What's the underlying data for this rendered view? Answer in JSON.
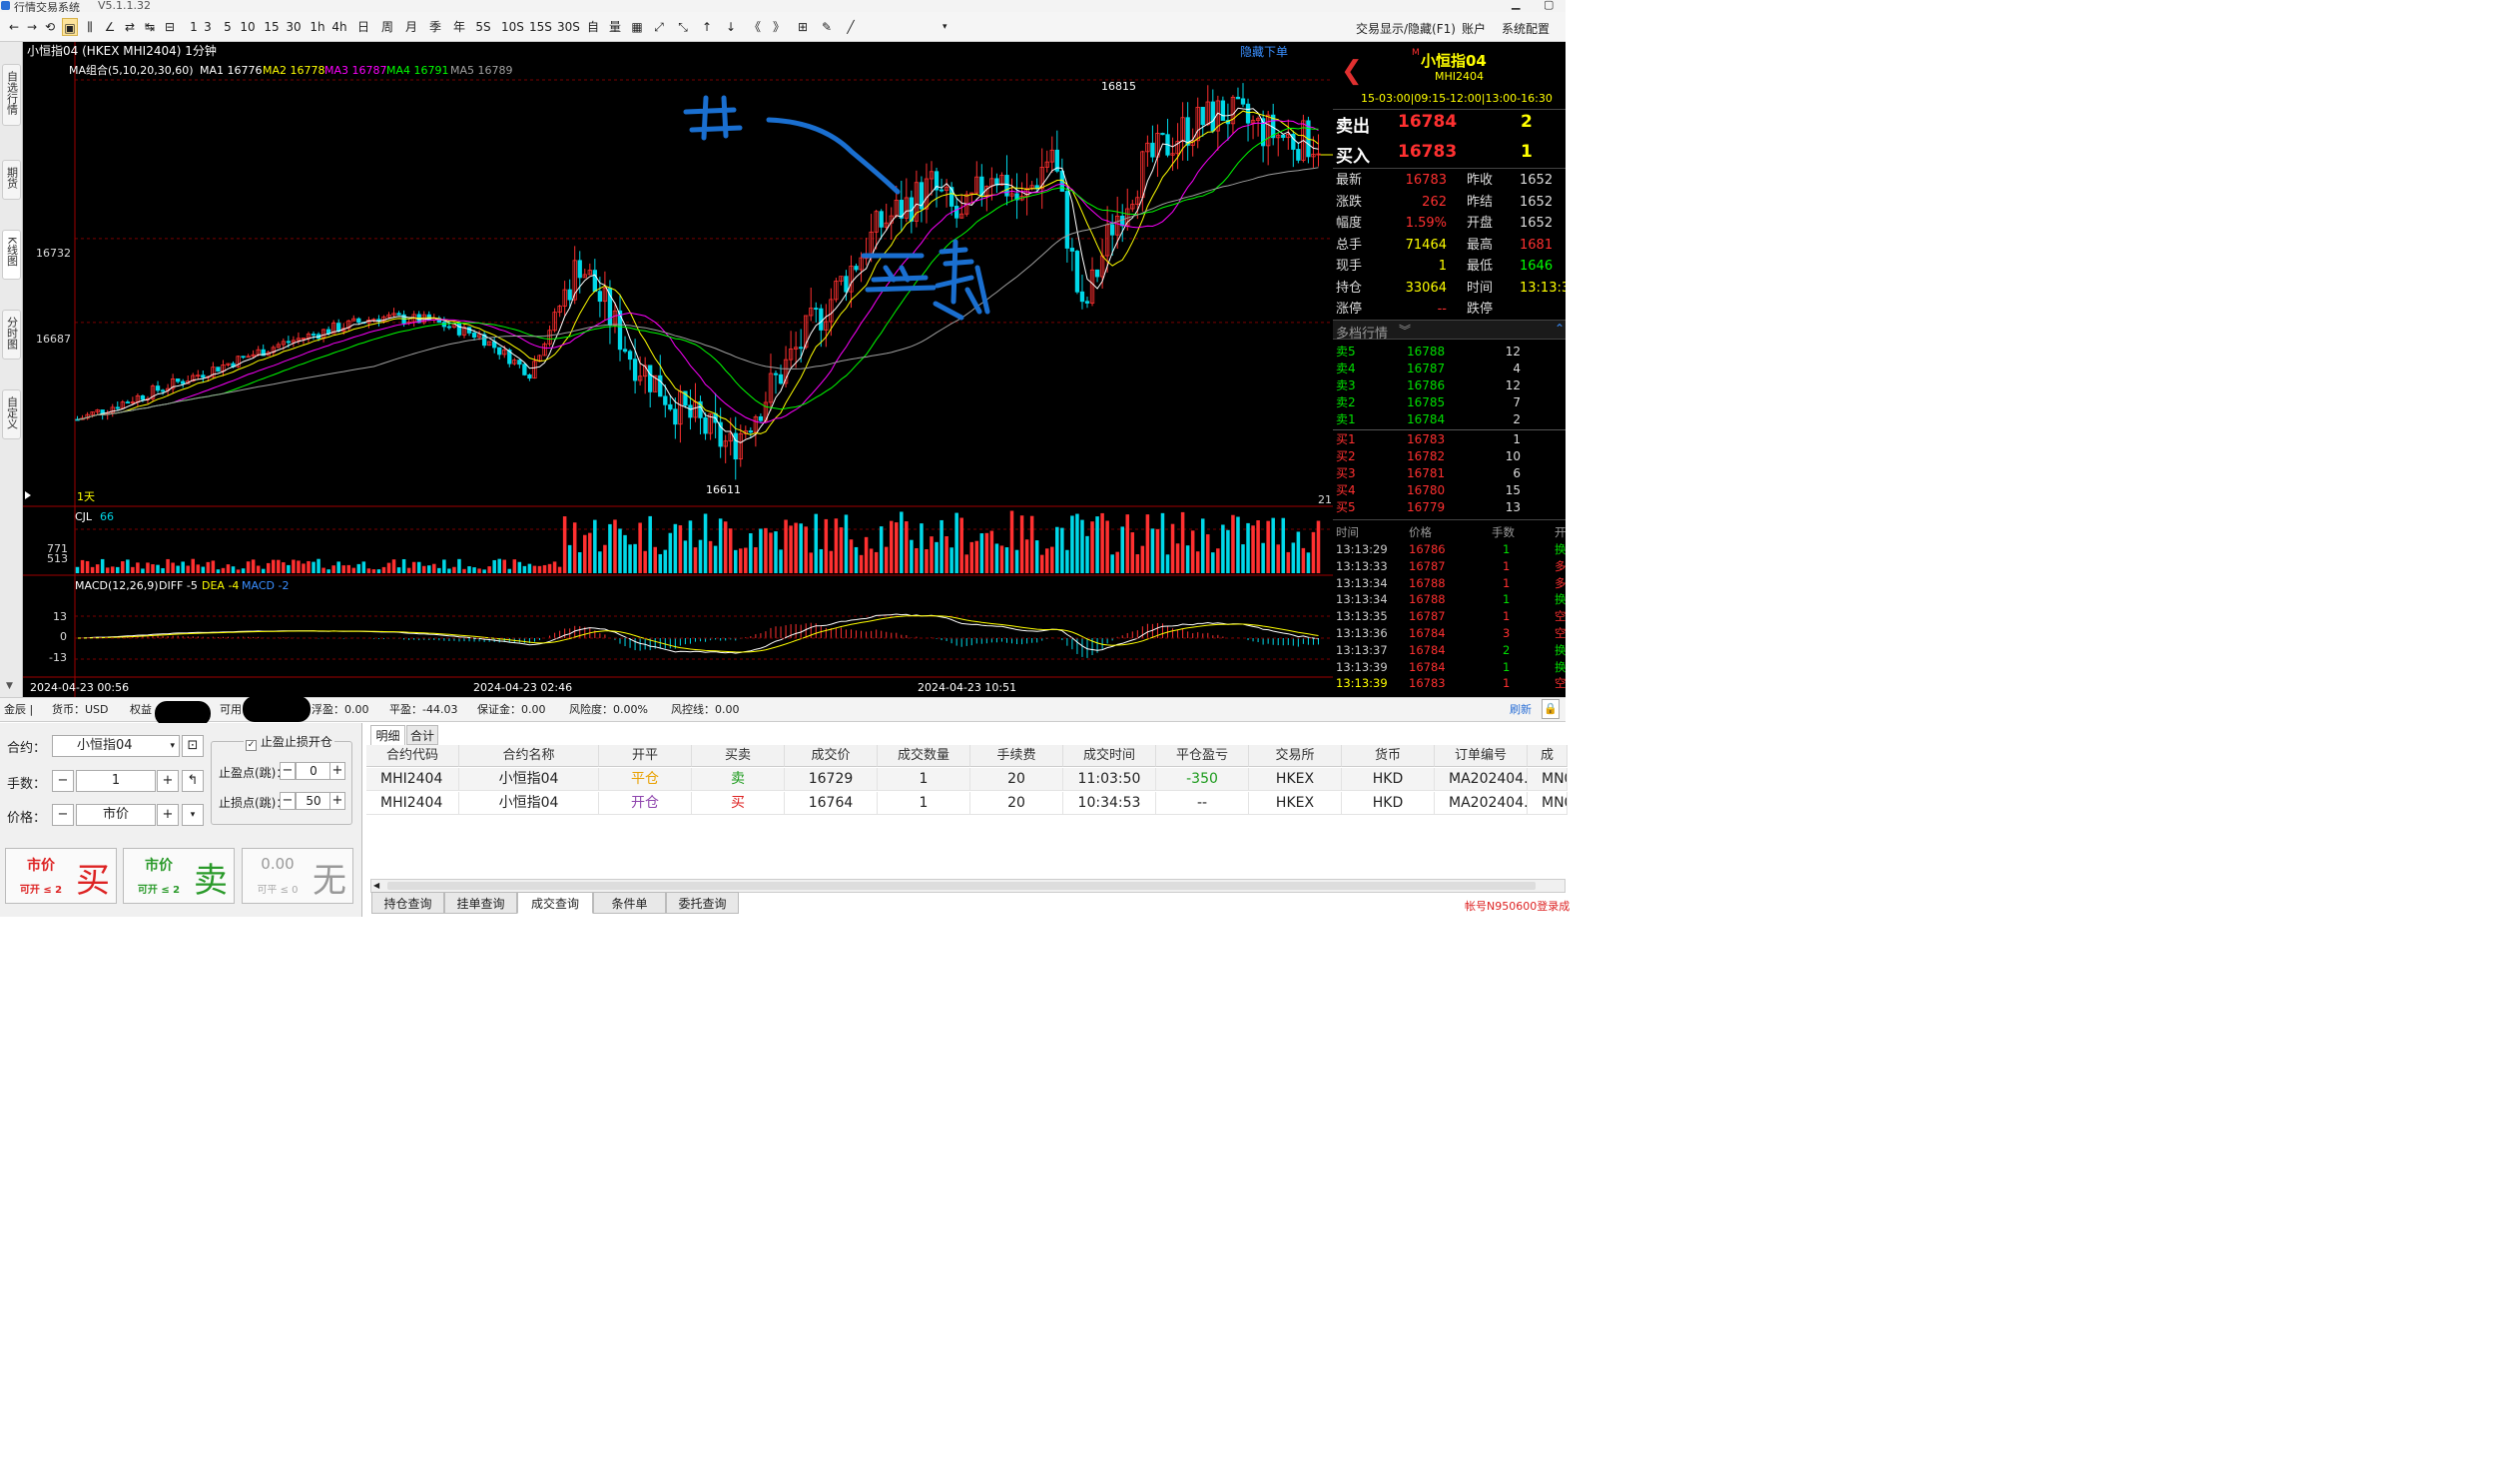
{
  "window": {
    "title": "行情交易系统",
    "version": "V5.1.1.32"
  },
  "toolbar": {
    "items": [
      "←",
      "→",
      "⟲",
      "▣",
      "⫼",
      "∠",
      "⇄",
      "↹",
      "⊟",
      "1",
      "3",
      "5",
      "10",
      "15",
      "30",
      "1h",
      "4h",
      "日",
      "周",
      "月",
      "季",
      "年",
      "5S",
      "10S",
      "15S",
      "30S",
      "自",
      "量",
      "▦",
      "⤢",
      "⤡",
      "↑",
      "↓",
      "《",
      "》",
      "⊞",
      "✎",
      "╱"
    ],
    "right_items": [
      "交易显示/隐藏(F1)",
      "账户",
      "系统配置"
    ]
  },
  "left_tabs": [
    "自选行情",
    "期货",
    "K线图",
    "分时图",
    "自定义"
  ],
  "chart": {
    "header": "小恒指04 (HKEX MHI2404) 1分钟",
    "hide_orders": "隐藏下单",
    "ma_legend": {
      "label": "MA组合(5,10,20,30,60)",
      "ma1": "MA1 16776",
      "ma2": "MA2 16778",
      "ma3": "MA3 16787",
      "ma4": "MA4 16791",
      "ma5": "MA5 16789"
    },
    "price_labels": [
      "16732",
      "16687"
    ],
    "high_label": "16815",
    "low_label": "16611",
    "period_label": "1天",
    "right_count": "21",
    "vol_legend": {
      "label": "CJL",
      "value": "66"
    },
    "vol_labels": [
      "771",
      "513"
    ],
    "macd_legend": {
      "label": "MACD(12,26,9)",
      "diff": "DIFF -5",
      "dea": "DEA -4",
      "macd": "MACD -2"
    },
    "macd_labels": [
      "13",
      "0",
      "-13"
    ],
    "time_labels": [
      "2024-04-23 00:56",
      "2024-04-23 02:46",
      "2024-04-23 10:51"
    ],
    "annotations": [
      "开",
      "止损"
    ],
    "colors": {
      "up": "#ff3030",
      "down": "#00d8e8",
      "ma1": "#ffffff",
      "ma2": "#ffff00",
      "ma3": "#ff00ff",
      "ma4": "#00ff00",
      "ma5": "#a0a0a0",
      "dea": "#ffff00",
      "diff": "#ffffff"
    }
  },
  "chart_data": {
    "type": "candlestick",
    "title": "小恒指04 (HKEX MHI2404) 1分钟",
    "ylim": [
      16590,
      16830
    ],
    "key_prices": {
      "high": 16815,
      "low": 16611,
      "gridlines": [
        16732,
        16687
      ]
    },
    "volume_levels": [
      771,
      513
    ],
    "macd_levels": [
      13,
      0,
      -13
    ],
    "x_labels": [
      "2024-04-23 00:56",
      "2024-04-23 02:46",
      "2024-04-23 10:51"
    ],
    "path_anchors": [
      [
        0,
        16635
      ],
      [
        5,
        16645
      ],
      [
        10,
        16655
      ],
      [
        15,
        16665
      ],
      [
        20,
        16675
      ],
      [
        25,
        16683
      ],
      [
        30,
        16690
      ],
      [
        35,
        16688
      ],
      [
        40,
        16680
      ],
      [
        45,
        16660
      ],
      [
        50,
        16720
      ],
      [
        52,
        16700
      ],
      [
        55,
        16670
      ],
      [
        60,
        16640
      ],
      [
        65,
        16620
      ],
      [
        70,
        16660
      ],
      [
        75,
        16700
      ],
      [
        80,
        16740
      ],
      [
        85,
        16760
      ],
      [
        88,
        16740
      ],
      [
        91,
        16770
      ],
      [
        94,
        16750
      ],
      [
        97,
        16780
      ],
      [
        100,
        16690
      ],
      [
        103,
        16740
      ],
      [
        106,
        16770
      ],
      [
        110,
        16790
      ],
      [
        114,
        16800
      ],
      [
        118,
        16790
      ],
      [
        121,
        16785
      ],
      [
        124,
        16784
      ]
    ]
  },
  "quote": {
    "name": "小恒指04",
    "code": "MHI2404",
    "sessions": "15-03:00|09:15-12:00|13:00-16:30",
    "sell_label": "卖出",
    "sell_price": "16784",
    "sell_qty": "2",
    "buy_label": "买入",
    "buy_price": "16783",
    "buy_qty": "1",
    "stats": [
      {
        "l": "最新",
        "v": "16783",
        "l2": "昨收",
        "v2": "1652"
      },
      {
        "l": "涨跌",
        "v": "262",
        "l2": "昨结",
        "v2": "1652"
      },
      {
        "l": "幅度",
        "v": "1.59%",
        "l2": "开盘",
        "v2": "1652"
      },
      {
        "l": "总手",
        "v": "71464",
        "l2": "最高",
        "v2": "1681"
      },
      {
        "l": "现手",
        "v": "1",
        "l2": "最低",
        "v2": "1646"
      },
      {
        "l": "持仓",
        "v": "33064",
        "l2": "时间",
        "v2": "13:13:3"
      },
      {
        "l": "涨停",
        "v": "--",
        "l2": "跌停",
        "v2": ""
      }
    ],
    "depth_title": "多档行情",
    "asks": [
      {
        "l": "卖5",
        "p": "16788",
        "q": "12"
      },
      {
        "l": "卖4",
        "p": "16787",
        "q": "4"
      },
      {
        "l": "卖3",
        "p": "16786",
        "q": "12"
      },
      {
        "l": "卖2",
        "p": "16785",
        "q": "7"
      },
      {
        "l": "卖1",
        "p": "16784",
        "q": "2"
      }
    ],
    "bids": [
      {
        "l": "买1",
        "p": "16783",
        "q": "1"
      },
      {
        "l": "买2",
        "p": "16782",
        "q": "10"
      },
      {
        "l": "买3",
        "p": "16781",
        "q": "6"
      },
      {
        "l": "买4",
        "p": "16780",
        "q": "15"
      },
      {
        "l": "买5",
        "p": "16779",
        "q": "13"
      }
    ],
    "tick_headers": [
      "时间",
      "价格",
      "手数",
      "开"
    ],
    "ticks": [
      {
        "t": "13:13:29",
        "p": "16786",
        "q": "1",
        "f": "换"
      },
      {
        "t": "13:13:33",
        "p": "16787",
        "q": "1",
        "f": "多"
      },
      {
        "t": "13:13:34",
        "p": "16788",
        "q": "1",
        "f": "多"
      },
      {
        "t": "13:13:34",
        "p": "16788",
        "q": "1",
        "f": "换"
      },
      {
        "t": "13:13:35",
        "p": "16787",
        "q": "1",
        "f": "空"
      },
      {
        "t": "13:13:36",
        "p": "16784",
        "q": "3",
        "f": "空"
      },
      {
        "t": "13:13:37",
        "p": "16784",
        "q": "2",
        "f": "换"
      },
      {
        "t": "13:13:39",
        "p": "16784",
        "q": "1",
        "f": "换"
      },
      {
        "t": "13:13:39",
        "p": "16783",
        "q": "1",
        "f": "空"
      }
    ]
  },
  "account": {
    "prefix": "金辰 |",
    "currency": "货币：USD",
    "equity": "权益",
    "available": "可用",
    "float": "浮盈：0.00",
    "close_pl": "平盈：-44.03",
    "margin": "保证金：0.00",
    "risk": "风险度：0.00%",
    "risk_line": "风控线：0.00",
    "refresh": "刷新"
  },
  "order": {
    "contract_label": "合约：",
    "contract_value": "小恒指04",
    "qty_label": "手数：",
    "qty_value": "1",
    "price_label": "价格：",
    "price_value": "市价",
    "stop_title": "止盈止损开仓",
    "tp_label": "止盈点(跳)：",
    "tp_value": "0",
    "sl_label": "止损点(跳)：",
    "sl_value": "50",
    "buy_btn": {
      "top": "市价",
      "sub": "可开 ≤ 2",
      "big": "买"
    },
    "sell_btn": {
      "top": "市价",
      "sub": "可开 ≤ 2",
      "big": "卖"
    },
    "none_btn": {
      "top": "0.00",
      "sub": "可平 ≤ 0",
      "big": "无"
    }
  },
  "trades": {
    "tabs": [
      "明细",
      "合计"
    ],
    "headers": [
      "合约代码",
      "合约名称",
      "开平",
      "买卖",
      "成交价",
      "成交数量",
      "手续费",
      "成交时间",
      "平仓盈亏",
      "交易所",
      "货币",
      "订单编号",
      "成"
    ],
    "rows": [
      [
        "MHI2404",
        "小恒指04",
        "平仓",
        "卖",
        "16729",
        "1",
        "20",
        "11:03:50",
        "-350",
        "HKEX",
        "HKD",
        "MA202404...",
        "MN0"
      ],
      [
        "MHI2404",
        "小恒指04",
        "开仓",
        "买",
        "16764",
        "1",
        "20",
        "10:34:53",
        "--",
        "HKEX",
        "HKD",
        "MA202404...",
        "MN0"
      ]
    ],
    "bottom_tabs": [
      "持仓查询",
      "挂单查询",
      "成交查询",
      "条件单",
      "委托查询"
    ],
    "status": "帐号N950600登录成"
  }
}
